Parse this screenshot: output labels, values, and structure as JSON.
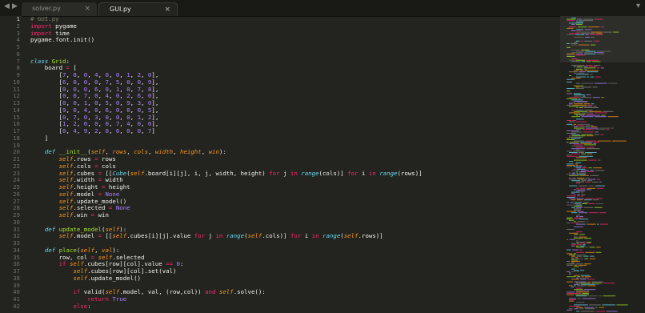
{
  "window": {
    "nav_back": "◀",
    "nav_forward": "▶",
    "tabs": [
      {
        "label": "solver.py",
        "close": "×"
      },
      {
        "label": "GUI.py",
        "close": "×"
      }
    ],
    "dropdown": "▾"
  },
  "editor": {
    "line_numbers": [
      "1",
      "2",
      "3",
      "4",
      "5",
      "6",
      "7",
      "8",
      "9",
      "10",
      "11",
      "12",
      "13",
      "14",
      "15",
      "16",
      "17",
      "18",
      "19",
      "20",
      "21",
      "22",
      "23",
      "24",
      "25",
      "26",
      "27",
      "28",
      "29",
      "30",
      "31",
      "32",
      "33",
      "34",
      "35",
      "36",
      "37",
      "38",
      "39",
      "40",
      "41",
      "42"
    ],
    "lines": [
      [
        [
          "c",
          "# GUI.py"
        ]
      ],
      [
        [
          "k",
          "import"
        ],
        [
          "d",
          " pygame"
        ]
      ],
      [
        [
          "k",
          "import"
        ],
        [
          "d",
          " time"
        ]
      ],
      [
        [
          "d",
          "pygame.font.init()"
        ]
      ],
      [],
      [],
      [
        [
          "b",
          "class"
        ],
        [
          "d",
          " "
        ],
        [
          "f",
          "Grid"
        ],
        [
          "d",
          ":"
        ]
      ],
      [
        [
          "d",
          "    board "
        ],
        [
          "k",
          "="
        ],
        [
          "d",
          " ["
        ]
      ],
      [
        [
          "d",
          "        ["
        ],
        [
          "n",
          "7"
        ],
        [
          "d",
          ", "
        ],
        [
          "n",
          "8"
        ],
        [
          "d",
          ", "
        ],
        [
          "n",
          "0"
        ],
        [
          "d",
          ", "
        ],
        [
          "n",
          "4"
        ],
        [
          "d",
          ", "
        ],
        [
          "n",
          "0"
        ],
        [
          "d",
          ", "
        ],
        [
          "n",
          "0"
        ],
        [
          "d",
          ", "
        ],
        [
          "n",
          "1"
        ],
        [
          "d",
          ", "
        ],
        [
          "n",
          "2"
        ],
        [
          "d",
          ", "
        ],
        [
          "n",
          "0"
        ],
        [
          "d",
          "],"
        ]
      ],
      [
        [
          "d",
          "        ["
        ],
        [
          "n",
          "6"
        ],
        [
          "d",
          ", "
        ],
        [
          "n",
          "0"
        ],
        [
          "d",
          ", "
        ],
        [
          "n",
          "0"
        ],
        [
          "d",
          ", "
        ],
        [
          "n",
          "0"
        ],
        [
          "d",
          ", "
        ],
        [
          "n",
          "7"
        ],
        [
          "d",
          ", "
        ],
        [
          "n",
          "5"
        ],
        [
          "d",
          ", "
        ],
        [
          "n",
          "0"
        ],
        [
          "d",
          ", "
        ],
        [
          "n",
          "0"
        ],
        [
          "d",
          ", "
        ],
        [
          "n",
          "9"
        ],
        [
          "d",
          "],"
        ]
      ],
      [
        [
          "d",
          "        ["
        ],
        [
          "n",
          "0"
        ],
        [
          "d",
          ", "
        ],
        [
          "n",
          "0"
        ],
        [
          "d",
          ", "
        ],
        [
          "n",
          "0"
        ],
        [
          "d",
          ", "
        ],
        [
          "n",
          "6"
        ],
        [
          "d",
          ", "
        ],
        [
          "n",
          "0"
        ],
        [
          "d",
          ", "
        ],
        [
          "n",
          "1"
        ],
        [
          "d",
          ", "
        ],
        [
          "n",
          "0"
        ],
        [
          "d",
          ", "
        ],
        [
          "n",
          "7"
        ],
        [
          "d",
          ", "
        ],
        [
          "n",
          "8"
        ],
        [
          "d",
          "],"
        ]
      ],
      [
        [
          "d",
          "        ["
        ],
        [
          "n",
          "0"
        ],
        [
          "d",
          ", "
        ],
        [
          "n",
          "0"
        ],
        [
          "d",
          ", "
        ],
        [
          "n",
          "7"
        ],
        [
          "d",
          ", "
        ],
        [
          "n",
          "0"
        ],
        [
          "d",
          ", "
        ],
        [
          "n",
          "4"
        ],
        [
          "d",
          ", "
        ],
        [
          "n",
          "0"
        ],
        [
          "d",
          ", "
        ],
        [
          "n",
          "2"
        ],
        [
          "d",
          ", "
        ],
        [
          "n",
          "6"
        ],
        [
          "d",
          ", "
        ],
        [
          "n",
          "0"
        ],
        [
          "d",
          "],"
        ]
      ],
      [
        [
          "d",
          "        ["
        ],
        [
          "n",
          "0"
        ],
        [
          "d",
          ", "
        ],
        [
          "n",
          "0"
        ],
        [
          "d",
          ", "
        ],
        [
          "n",
          "1"
        ],
        [
          "d",
          ", "
        ],
        [
          "n",
          "0"
        ],
        [
          "d",
          ", "
        ],
        [
          "n",
          "5"
        ],
        [
          "d",
          ", "
        ],
        [
          "n",
          "0"
        ],
        [
          "d",
          ", "
        ],
        [
          "n",
          "9"
        ],
        [
          "d",
          ", "
        ],
        [
          "n",
          "3"
        ],
        [
          "d",
          ", "
        ],
        [
          "n",
          "0"
        ],
        [
          "d",
          "],"
        ]
      ],
      [
        [
          "d",
          "        ["
        ],
        [
          "n",
          "9"
        ],
        [
          "d",
          ", "
        ],
        [
          "n",
          "0"
        ],
        [
          "d",
          ", "
        ],
        [
          "n",
          "4"
        ],
        [
          "d",
          ", "
        ],
        [
          "n",
          "0"
        ],
        [
          "d",
          ", "
        ],
        [
          "n",
          "6"
        ],
        [
          "d",
          ", "
        ],
        [
          "n",
          "0"
        ],
        [
          "d",
          ", "
        ],
        [
          "n",
          "0"
        ],
        [
          "d",
          ", "
        ],
        [
          "n",
          "0"
        ],
        [
          "d",
          ", "
        ],
        [
          "n",
          "5"
        ],
        [
          "d",
          "],"
        ]
      ],
      [
        [
          "d",
          "        ["
        ],
        [
          "n",
          "0"
        ],
        [
          "d",
          ", "
        ],
        [
          "n",
          "7"
        ],
        [
          "d",
          ", "
        ],
        [
          "n",
          "0"
        ],
        [
          "d",
          ", "
        ],
        [
          "n",
          "3"
        ],
        [
          "d",
          ", "
        ],
        [
          "n",
          "0"
        ],
        [
          "d",
          ", "
        ],
        [
          "n",
          "0"
        ],
        [
          "d",
          ", "
        ],
        [
          "n",
          "0"
        ],
        [
          "d",
          ", "
        ],
        [
          "n",
          "1"
        ],
        [
          "d",
          ", "
        ],
        [
          "n",
          "2"
        ],
        [
          "d",
          "],"
        ]
      ],
      [
        [
          "d",
          "        ["
        ],
        [
          "n",
          "1"
        ],
        [
          "d",
          ", "
        ],
        [
          "n",
          "2"
        ],
        [
          "d",
          ", "
        ],
        [
          "n",
          "0"
        ],
        [
          "d",
          ", "
        ],
        [
          "n",
          "0"
        ],
        [
          "d",
          ", "
        ],
        [
          "n",
          "0"
        ],
        [
          "d",
          ", "
        ],
        [
          "n",
          "7"
        ],
        [
          "d",
          ", "
        ],
        [
          "n",
          "4"
        ],
        [
          "d",
          ", "
        ],
        [
          "n",
          "0"
        ],
        [
          "d",
          ", "
        ],
        [
          "n",
          "0"
        ],
        [
          "d",
          "],"
        ]
      ],
      [
        [
          "d",
          "        ["
        ],
        [
          "n",
          "0"
        ],
        [
          "d",
          ", "
        ],
        [
          "n",
          "4"
        ],
        [
          "d",
          ", "
        ],
        [
          "n",
          "9"
        ],
        [
          "d",
          ", "
        ],
        [
          "n",
          "2"
        ],
        [
          "d",
          ", "
        ],
        [
          "n",
          "0"
        ],
        [
          "d",
          ", "
        ],
        [
          "n",
          "6"
        ],
        [
          "d",
          ", "
        ],
        [
          "n",
          "0"
        ],
        [
          "d",
          ", "
        ],
        [
          "n",
          "0"
        ],
        [
          "d",
          ", "
        ],
        [
          "n",
          "7"
        ],
        [
          "d",
          "]"
        ]
      ],
      [
        [
          "d",
          "    ]"
        ]
      ],
      [],
      [
        [
          "d",
          "    "
        ],
        [
          "b",
          "def"
        ],
        [
          "d",
          " "
        ],
        [
          "f",
          "__init__"
        ],
        [
          "d",
          "("
        ],
        [
          "p",
          "self"
        ],
        [
          "d",
          ", "
        ],
        [
          "p",
          "rows"
        ],
        [
          "d",
          ", "
        ],
        [
          "p",
          "cols"
        ],
        [
          "d",
          ", "
        ],
        [
          "p",
          "width"
        ],
        [
          "d",
          ", "
        ],
        [
          "p",
          "height"
        ],
        [
          "d",
          ", "
        ],
        [
          "p",
          "win"
        ],
        [
          "d",
          "):"
        ]
      ],
      [
        [
          "d",
          "        "
        ],
        [
          "x",
          "self"
        ],
        [
          "d",
          ".rows "
        ],
        [
          "k",
          "="
        ],
        [
          "d",
          " rows"
        ]
      ],
      [
        [
          "d",
          "        "
        ],
        [
          "x",
          "self"
        ],
        [
          "d",
          ".cols "
        ],
        [
          "k",
          "="
        ],
        [
          "d",
          " cols"
        ]
      ],
      [
        [
          "d",
          "        "
        ],
        [
          "x",
          "self"
        ],
        [
          "d",
          ".cubes "
        ],
        [
          "k",
          "="
        ],
        [
          "d",
          " [["
        ],
        [
          "b",
          "Cube"
        ],
        [
          "d",
          "("
        ],
        [
          "x",
          "self"
        ],
        [
          "d",
          ".board[i][j], i, j, width, height) "
        ],
        [
          "k",
          "for"
        ],
        [
          "d",
          " j "
        ],
        [
          "k",
          "in"
        ],
        [
          "d",
          " "
        ],
        [
          "b",
          "range"
        ],
        [
          "d",
          "(cols)] "
        ],
        [
          "k",
          "for"
        ],
        [
          "d",
          " i "
        ],
        [
          "k",
          "in"
        ],
        [
          "d",
          " "
        ],
        [
          "b",
          "range"
        ],
        [
          "d",
          "(rows)]"
        ]
      ],
      [
        [
          "d",
          "        "
        ],
        [
          "x",
          "self"
        ],
        [
          "d",
          ".width "
        ],
        [
          "k",
          "="
        ],
        [
          "d",
          " width"
        ]
      ],
      [
        [
          "d",
          "        "
        ],
        [
          "x",
          "self"
        ],
        [
          "d",
          ".height "
        ],
        [
          "k",
          "="
        ],
        [
          "d",
          " height"
        ]
      ],
      [
        [
          "d",
          "        "
        ],
        [
          "x",
          "self"
        ],
        [
          "d",
          ".model "
        ],
        [
          "k",
          "="
        ],
        [
          "d",
          " "
        ],
        [
          "n",
          "None"
        ]
      ],
      [
        [
          "d",
          "        "
        ],
        [
          "x",
          "self"
        ],
        [
          "d",
          ".update_model()"
        ]
      ],
      [
        [
          "d",
          "        "
        ],
        [
          "x",
          "self"
        ],
        [
          "d",
          ".selected "
        ],
        [
          "k",
          "="
        ],
        [
          "d",
          " "
        ],
        [
          "n",
          "None"
        ]
      ],
      [
        [
          "d",
          "        "
        ],
        [
          "x",
          "self"
        ],
        [
          "d",
          ".win "
        ],
        [
          "k",
          "="
        ],
        [
          "d",
          " win"
        ]
      ],
      [],
      [
        [
          "d",
          "    "
        ],
        [
          "b",
          "def"
        ],
        [
          "d",
          " "
        ],
        [
          "f",
          "update_model"
        ],
        [
          "d",
          "("
        ],
        [
          "p",
          "self"
        ],
        [
          "d",
          "):"
        ]
      ],
      [
        [
          "d",
          "        "
        ],
        [
          "x",
          "self"
        ],
        [
          "d",
          ".model "
        ],
        [
          "k",
          "="
        ],
        [
          "d",
          " [["
        ],
        [
          "x",
          "self"
        ],
        [
          "d",
          ".cubes[i][j].value "
        ],
        [
          "k",
          "for"
        ],
        [
          "d",
          " j "
        ],
        [
          "k",
          "in"
        ],
        [
          "d",
          " "
        ],
        [
          "b",
          "range"
        ],
        [
          "d",
          "("
        ],
        [
          "x",
          "self"
        ],
        [
          "d",
          ".cols)] "
        ],
        [
          "k",
          "for"
        ],
        [
          "d",
          " i "
        ],
        [
          "k",
          "in"
        ],
        [
          "d",
          " "
        ],
        [
          "b",
          "range"
        ],
        [
          "d",
          "("
        ],
        [
          "x",
          "self"
        ],
        [
          "d",
          ".rows)]"
        ]
      ],
      [],
      [
        [
          "d",
          "    "
        ],
        [
          "b",
          "def"
        ],
        [
          "d",
          " "
        ],
        [
          "f",
          "place"
        ],
        [
          "d",
          "("
        ],
        [
          "p",
          "self"
        ],
        [
          "d",
          ", "
        ],
        [
          "p",
          "val"
        ],
        [
          "d",
          "):"
        ]
      ],
      [
        [
          "d",
          "        row, col "
        ],
        [
          "k",
          "="
        ],
        [
          "d",
          " "
        ],
        [
          "x",
          "self"
        ],
        [
          "d",
          ".selected"
        ]
      ],
      [
        [
          "d",
          "        "
        ],
        [
          "k",
          "if"
        ],
        [
          "d",
          " "
        ],
        [
          "x",
          "self"
        ],
        [
          "d",
          ".cubes[row][col].value "
        ],
        [
          "k",
          "=="
        ],
        [
          "d",
          " "
        ],
        [
          "n",
          "0"
        ],
        [
          "d",
          ":"
        ]
      ],
      [
        [
          "d",
          "            "
        ],
        [
          "x",
          "self"
        ],
        [
          "d",
          ".cubes[row][col].set(val)"
        ]
      ],
      [
        [
          "d",
          "            "
        ],
        [
          "x",
          "self"
        ],
        [
          "d",
          ".update_model()"
        ]
      ],
      [],
      [
        [
          "d",
          "            "
        ],
        [
          "k",
          "if"
        ],
        [
          "d",
          " valid("
        ],
        [
          "x",
          "self"
        ],
        [
          "d",
          ".model, val, (row,col)) "
        ],
        [
          "k",
          "and"
        ],
        [
          "d",
          " "
        ],
        [
          "x",
          "self"
        ],
        [
          "d",
          ".solve():"
        ]
      ],
      [
        [
          "d",
          "                "
        ],
        [
          "k",
          "return"
        ],
        [
          "d",
          " "
        ],
        [
          "n",
          "True"
        ]
      ],
      [
        [
          "d",
          "            "
        ],
        [
          "k",
          "else"
        ],
        [
          "d",
          ":"
        ]
      ]
    ]
  },
  "colors": {
    "background": "#23241f",
    "comment": "#7b7a6c",
    "keyword": "#f92672",
    "function": "#a6e22e",
    "builtin": "#66d9ef",
    "param": "#fd971f",
    "number": "#ae81ff"
  }
}
